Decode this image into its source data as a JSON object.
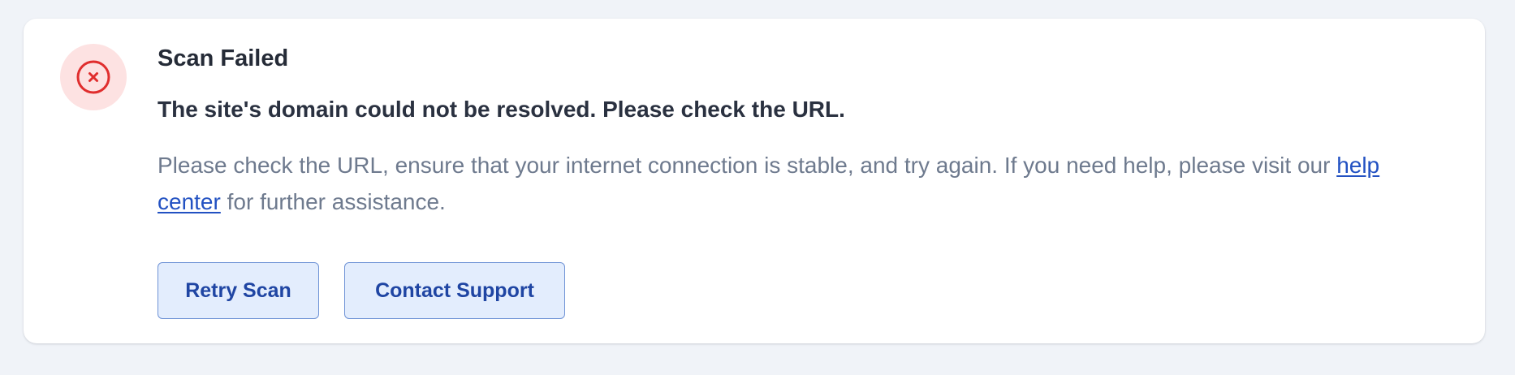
{
  "alert": {
    "icon": "circle-x-icon",
    "title": "Scan Failed",
    "message": "The site's domain could not be resolved. Please check the URL.",
    "details_before_link": "Please check the URL, ensure that your internet connection is stable, and try again. If you need help, please visit our ",
    "help_link_text": "help center",
    "details_after_link": " for further assistance."
  },
  "actions": {
    "retry_label": "Retry Scan",
    "contact_label": "Contact Support"
  },
  "colors": {
    "error_accent": "#e02e2e",
    "error_bg": "#fde2e2",
    "link": "#2251c2",
    "button_bg": "#e3edfd",
    "button_border": "#6f93d6",
    "button_text": "#1f45a3"
  }
}
